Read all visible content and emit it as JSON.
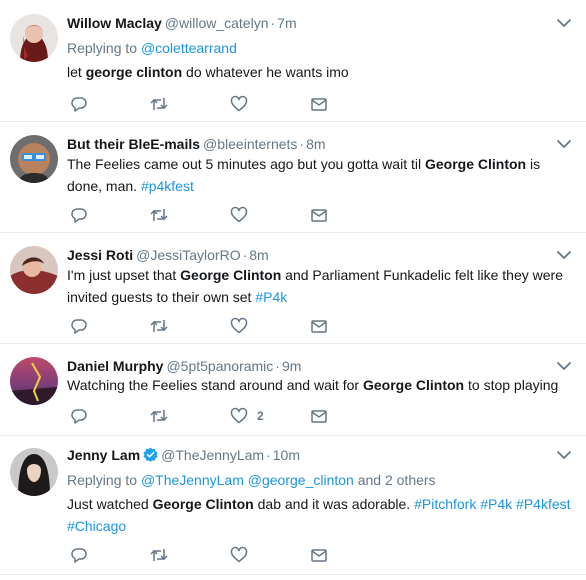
{
  "colors": {
    "accent": "#1b95e0",
    "muted": "#657786",
    "text": "#14171a",
    "divider": "#e6ecf0"
  },
  "tweets": [
    {
      "name": "Willow Maclay",
      "handle": "@willow_catelyn",
      "time": "7m",
      "replying_label": "Replying to",
      "replying_to": [
        "@colettearrand"
      ],
      "replying_extra": "",
      "text": {
        "before": "let ",
        "bold": "george clinton",
        "after": " do whatever he wants imo",
        "tags": []
      },
      "likes": ""
    },
    {
      "name": "But their BleE-mails",
      "handle": "@bleeinternets",
      "time": "8m",
      "text": {
        "before": "The Feelies came out 5 minutes ago but you gotta wait til ",
        "bold": "George Clinton",
        "after": " is done, man. ",
        "tags": [
          "#p4kfest"
        ]
      },
      "likes": ""
    },
    {
      "name": "Jessi Roti",
      "handle": "@JessiTaylorRO",
      "time": "8m",
      "text": {
        "before": "I'm just upset that ",
        "bold": "George Clinton",
        "after": " and Parliament Funkadelic felt like they were invited guests to their own set ",
        "tags": [
          "#P4k"
        ]
      },
      "likes": ""
    },
    {
      "name": "Daniel Murphy",
      "handle": "@5pt5panoramic",
      "time": "9m",
      "text": {
        "before": "Watching the Feelies stand around and wait for ",
        "bold": "George Clinton",
        "after": " to stop playing",
        "tags": []
      },
      "likes": "2"
    },
    {
      "name": "Jenny Lam",
      "handle": "@TheJennyLam",
      "time": "10m",
      "verified": true,
      "replying_label": "Replying to",
      "replying_to": [
        "@TheJennyLam",
        "@george_clinton"
      ],
      "replying_extra": "and 2 others",
      "text": {
        "before": "Just watched ",
        "bold": "George Clinton",
        "after": " dab and it was adorable. ",
        "tags": [
          "#Pitchfork",
          "#P4k",
          "#P4kfest",
          "#Chicago"
        ]
      },
      "likes": ""
    }
  ],
  "icons": {
    "reply": "reply-icon",
    "retweet": "retweet-icon",
    "like": "heart-icon",
    "dm": "envelope-icon",
    "more": "chevron-down-icon",
    "verified": "verified-badge-icon"
  }
}
